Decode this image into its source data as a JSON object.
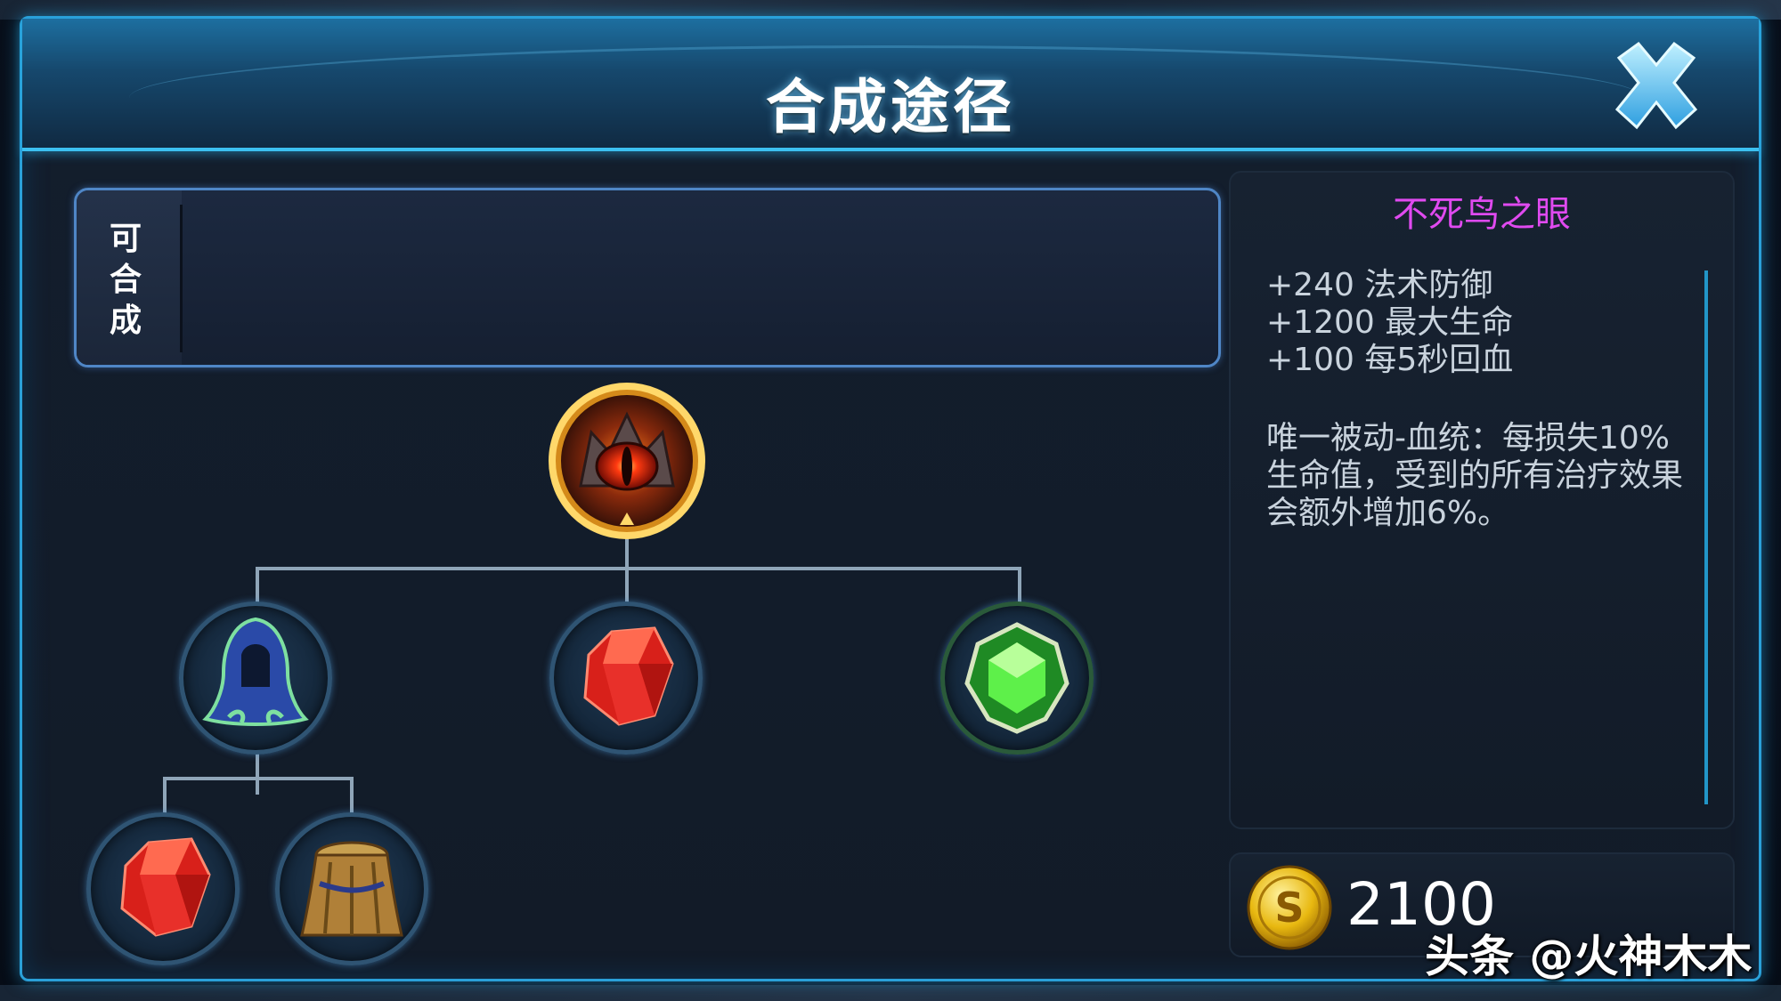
{
  "dialog": {
    "title": "合成途径"
  },
  "craftable_panel": {
    "label": "可合成",
    "items": []
  },
  "tree": {
    "root": {
      "icon": "phoenix-eye-icon"
    },
    "children": [
      {
        "icon": "cloak-icon",
        "children": [
          {
            "icon": "red-crystal-icon"
          },
          {
            "icon": "leather-armor-icon"
          }
        ]
      },
      {
        "icon": "red-crystal-icon"
      },
      {
        "icon": "green-gem-icon"
      }
    ]
  },
  "info": {
    "name": "不死鸟之眼",
    "name_color": "#e04af0",
    "stats": [
      "+240 法术防御",
      "+1200 最大生命",
      "+100 每5秒回血"
    ],
    "passive_lines": [
      "唯一被动-血统：每损失10%",
      "生命值，受到的所有治疗效果",
      "会额外增加6%。"
    ]
  },
  "price": {
    "icon": "gold-coin-icon",
    "value": "2100"
  },
  "watermark": "头条 @火神木木",
  "colors": {
    "accent": "#2aa0d8",
    "title_text": "#ffffff",
    "body_text": "#c9d3dd"
  }
}
